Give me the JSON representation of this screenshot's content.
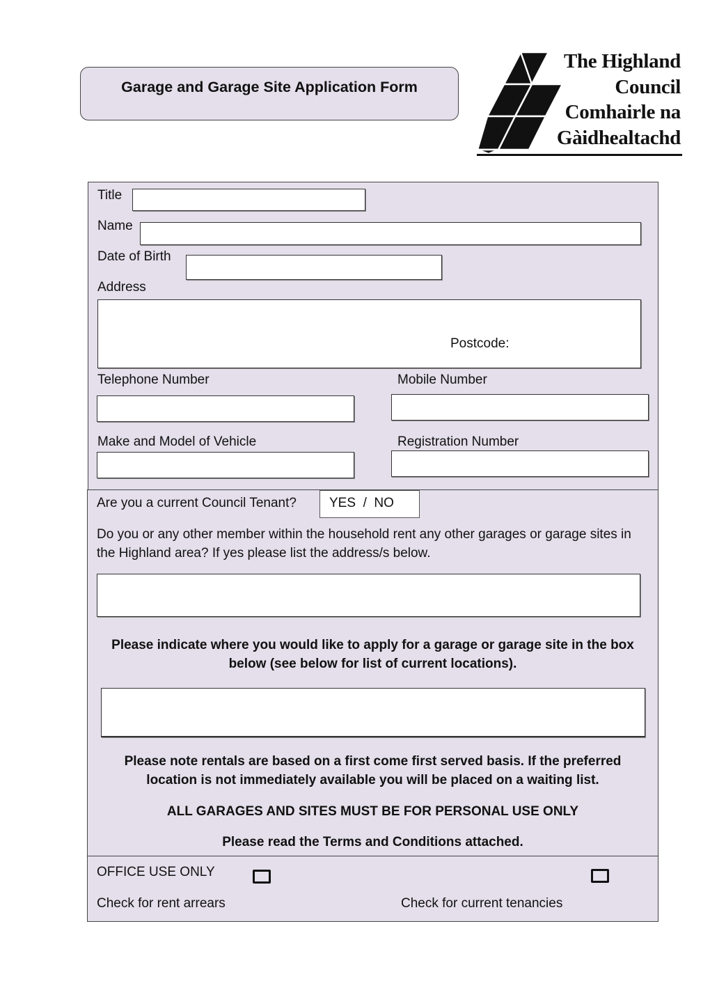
{
  "header": {
    "form_title": "Garage and Garage Site Application Form",
    "logo": {
      "icon": "highland-council-triangles-logo",
      "lines": [
        "The Highland",
        "Council",
        "Comhairle na",
        "Gàidhealtachd"
      ]
    }
  },
  "personal_details": {
    "title_label": "Title",
    "title_value": "",
    "name_label": "Name",
    "name_value": "",
    "dob_label": "Date of Birth",
    "dob_value": "",
    "address_label": "Address",
    "address_value": "",
    "postcode_label": "Postcode:",
    "telephone_label": "Telephone Number",
    "telephone_value": "",
    "mobile_label": "Mobile Number",
    "mobile_value": "",
    "vehicle_label": "Make and Model of Vehicle",
    "vehicle_value": "",
    "registration_label": "Registration Number",
    "registration_value": ""
  },
  "tenancy": {
    "tenant_question": "Are you a current Council Tenant?",
    "tenant_options": "YES  /  NO",
    "other_rentals_question": "Do you or any other member within the household rent any other garages or garage sites in the Highland area? If yes please list the address/s below.",
    "other_rentals_value": "",
    "location_instruction": "Please indicate where you would like to apply for a garage or garage site in the box below (see below for list of current locations).",
    "location_value": "",
    "rental_note": "Please note rentals are based on a first come first served basis. If the preferred location is not immediately available you will be placed on a waiting list.",
    "personal_use_note": "ALL GARAGES AND SITES MUST BE FOR PERSONAL USE ONLY",
    "terms_note": "Please read the Terms and Conditions attached."
  },
  "office_use": {
    "heading": "OFFICE USE ONLY",
    "rent_arrears_label": "Check for rent arrears",
    "rent_arrears_checked": false,
    "current_tenancies_label": "Check for current tenancies",
    "current_tenancies_checked": false
  }
}
